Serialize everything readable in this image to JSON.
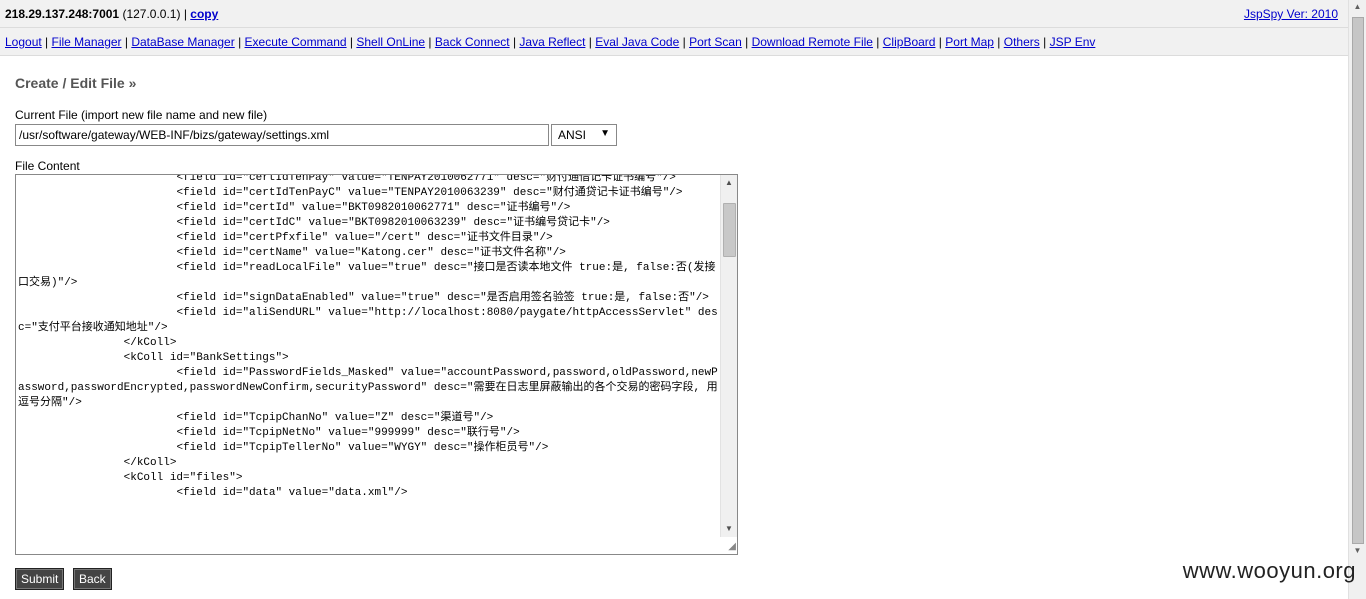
{
  "topbar": {
    "host": "218.29.137.248:7001",
    "local": " (127.0.0.1) | ",
    "copy": "copy",
    "version": "JspSpy Ver: 2010"
  },
  "nav": [
    "Logout",
    "File Manager",
    "DataBase Manager",
    "Execute Command",
    "Shell OnLine",
    "Back Connect",
    "Java Reflect",
    "Eval Java Code",
    "Port Scan",
    "Download Remote File",
    "ClipBoard",
    "Port Map",
    "Others",
    "JSP Env"
  ],
  "form": {
    "heading": "Create / Edit File »",
    "current_label": "Current File (import new file name and new file)",
    "path": "/usr/software/gateway/WEB-INF/bizs/gateway/settings.xml",
    "encoding": "ANSI",
    "content_label": "File Content",
    "content": "                        <field id=\"certIdTenPay\" value=\"TENPAY2010062771\" desc=\"财付通借记卡证书编号\"/>\n                        <field id=\"certIdTenPayC\" value=\"TENPAY2010063239\" desc=\"财付通贷记卡证书编号\"/>\n                        <field id=\"certId\" value=\"BKT0982010062771\" desc=\"证书编号\"/>\n                        <field id=\"certIdC\" value=\"BKT0982010063239\" desc=\"证书编号贷记卡\"/>\n                        <field id=\"certPfxfile\" value=\"/cert\" desc=\"证书文件目录\"/>\n                        <field id=\"certName\" value=\"Katong.cer\" desc=\"证书文件名称\"/>\n                        <field id=\"readLocalFile\" value=\"true\" desc=\"接口是否读本地文件 true:是, false:否(发接口交易)\"/>\n                        <field id=\"signDataEnabled\" value=\"true\" desc=\"是否启用签名验签 true:是, false:否\"/>\n                        <field id=\"aliSendURL\" value=\"http://localhost:8080/paygate/httpAccessServlet\" desc=\"支付平台接收通知地址\"/>\n                </kColl>\n                <kColl id=\"BankSettings\">\n                        <field id=\"PasswordFields_Masked\" value=\"accountPassword,password,oldPassword,newPassword,passwordEncrypted,passwordNewConfirm,securityPassword\" desc=\"需要在日志里屏蔽输出的各个交易的密码字段, 用逗号分隔\"/>\n                        <field id=\"TcpipChanNo\" value=\"Z\" desc=\"渠道号\"/>\n                        <field id=\"TcpipNetNo\" value=\"999999\" desc=\"联行号\"/>\n                        <field id=\"TcpipTellerNo\" value=\"WYGY\" desc=\"操作柜员号\"/>\n                </kColl>\n                <kColl id=\"files\">\n                        <field id=\"data\" value=\"data.xml\"/>",
    "submit": "Submit",
    "back": "Back"
  },
  "watermark": "www.wooyun.org"
}
